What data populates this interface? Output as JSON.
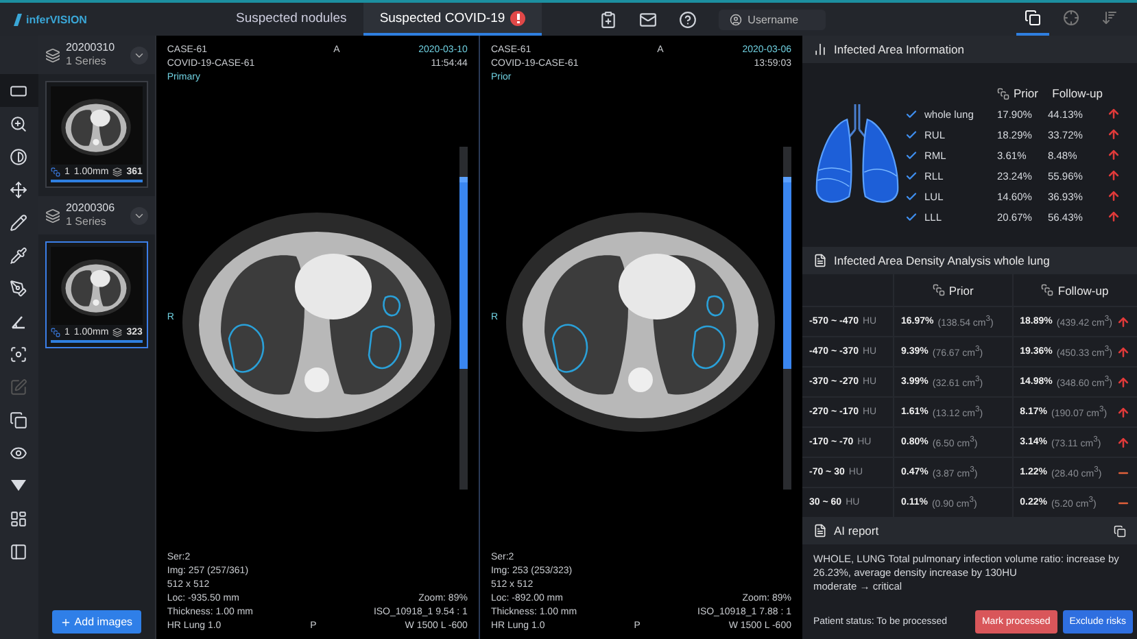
{
  "header": {
    "logo": "inferVISION",
    "tabs": [
      {
        "label": "Suspected nodules",
        "selected": false,
        "alert": false
      },
      {
        "label": "Suspected COVID-19",
        "selected": true,
        "alert": true
      }
    ],
    "actions": [
      {
        "kind": "clipboard"
      },
      {
        "kind": "mail"
      },
      {
        "kind": "help"
      }
    ],
    "user": "Username",
    "view_modes": [
      {
        "kind": "copy",
        "selected": true
      },
      {
        "kind": "target",
        "selected": false
      },
      {
        "kind": "sort",
        "selected": false
      }
    ]
  },
  "tools": [
    {
      "kind": "frame",
      "selected": true,
      "disabled": false
    },
    {
      "kind": "zoom",
      "selected": false,
      "disabled": false
    },
    {
      "kind": "contrast",
      "selected": false,
      "disabled": false
    },
    {
      "kind": "move",
      "selected": false,
      "disabled": false
    },
    {
      "kind": "pencil",
      "selected": false,
      "disabled": false
    },
    {
      "kind": "pipette",
      "selected": false,
      "disabled": false
    },
    {
      "kind": "pen",
      "selected": false,
      "disabled": false
    },
    {
      "kind": "angle",
      "selected": false,
      "disabled": false
    },
    {
      "kind": "focus",
      "selected": false,
      "disabled": false
    },
    {
      "kind": "edit",
      "selected": false,
      "disabled": true
    },
    {
      "kind": "layers",
      "selected": false,
      "disabled": false
    },
    {
      "kind": "eye",
      "selected": false,
      "disabled": false
    },
    {
      "kind": "more",
      "selected": false,
      "disabled": false
    },
    {
      "kind": "grid",
      "selected": false,
      "disabled": false
    },
    {
      "kind": "panel",
      "selected": false,
      "disabled": false
    }
  ],
  "series": [
    {
      "date": "20200310",
      "count": "1 Series",
      "selected": false,
      "slice": "1",
      "thickness": "1.00mm",
      "images": "361"
    },
    {
      "date": "20200306",
      "count": "1 Series",
      "selected": true,
      "slice": "1",
      "thickness": "1.00mm",
      "images": "323"
    }
  ],
  "add_images": "Add images",
  "viewers": [
    {
      "case": "CASE-61",
      "study": "COVID-19-CASE-61",
      "role": "Primary",
      "date": "2020-03-10",
      "time": "11:54:44",
      "top": "A",
      "bottom": "P",
      "left": "R",
      "info_left": [
        "Ser:2",
        "Img: 257 (257/361)",
        "512 x 512",
        "Loc: -935.50 mm",
        "Thickness: 1.00 mm",
        "HR Lung 1.0"
      ],
      "info_right": [
        "Zoom: 89%",
        "ISO_10918_1 9.54 : 1",
        "W 1500 L -600"
      ]
    },
    {
      "case": "CASE-61",
      "study": "COVID-19-CASE-61",
      "role": "Prior",
      "date": "2020-03-06",
      "time": "13:59:03",
      "top": "A",
      "bottom": "P",
      "left": "R",
      "info_left": [
        "Ser:2",
        "Img: 253 (253/323)",
        "512 x 512",
        "Loc: -892.00 mm",
        "Thickness: 1.00 mm",
        "HR Lung 1.0"
      ],
      "info_right": [
        "Zoom: 89%",
        "ISO_10918_1 7.88 : 1",
        "W 1500 L -600"
      ]
    }
  ],
  "infected_area": {
    "title": "Infected Area Information",
    "columns": [
      "Prior",
      "Follow-up"
    ],
    "rows": [
      {
        "label": "whole lung",
        "checked": true,
        "prior": "17.90%",
        "followup": "44.13%",
        "increased": true
      },
      {
        "label": "RUL",
        "checked": true,
        "prior": "18.29%",
        "followup": "33.72%",
        "increased": true
      },
      {
        "label": "RML",
        "checked": true,
        "prior": "3.61%",
        "followup": "8.48%",
        "increased": true
      },
      {
        "label": "RLL",
        "checked": true,
        "prior": "23.24%",
        "followup": "55.96%",
        "increased": true
      },
      {
        "label": "LUL",
        "checked": true,
        "prior": "14.60%",
        "followup": "36.93%",
        "increased": true
      },
      {
        "label": "LLL",
        "checked": true,
        "prior": "20.67%",
        "followup": "56.43%",
        "increased": true
      }
    ]
  },
  "density": {
    "title": "Infected Area Density Analysis whole lung",
    "columns": [
      "Prior",
      "Follow-up"
    ],
    "rows": [
      {
        "range": "-570 ~ -470",
        "unit": "HU",
        "prior": "16.97%",
        "prior_volume": "(138.54 cm$^{3}$)",
        "followup": "18.89%",
        "followup_volume": "(439.42 cm$^{3}$)",
        "increased": true
      },
      {
        "range": "-470 ~ -370",
        "unit": "HU",
        "prior": "9.39%",
        "prior_volume": "(76.67 cm$^{3}$)",
        "followup": "19.36%",
        "followup_volume": "(450.33 cm$^{3}$)",
        "increased": true
      },
      {
        "range": "-370 ~ -270",
        "unit": "HU",
        "prior": "3.99%",
        "prior_volume": "(32.61 cm$^{3}$)",
        "followup": "14.98%",
        "followup_volume": "(348.60 cm$^{3}$)",
        "increased": true
      },
      {
        "range": "-270 ~ -170",
        "unit": "HU",
        "prior": "1.61%",
        "prior_volume": "(13.12 cm$^{3}$)",
        "followup": "8.17%",
        "followup_volume": "(190.07 cm$^{3}$)",
        "increased": true
      },
      {
        "range": "-170 ~ -70",
        "unit": "HU",
        "prior": "0.80%",
        "prior_volume": "(6.50 cm$^{3}$)",
        "followup": "3.14%",
        "followup_volume": "(73.11 cm$^{3}$)",
        "increased": true
      },
      {
        "range": "-70 ~ 30",
        "unit": "HU",
        "prior": "0.47%",
        "prior_volume": "(3.87 cm$^{3}$)",
        "followup": "1.22%",
        "followup_volume": "(28.40 cm$^{3}$)",
        "increased": false
      },
      {
        "range": "30 ~ 60",
        "unit": "HU",
        "prior": "0.11%",
        "prior_volume": "(0.90 cm$^{3}$)",
        "followup": "0.22%",
        "followup_volume": "(5.20 cm$^{3}$)",
        "increased": false
      }
    ]
  },
  "ai_report": {
    "title": "AI report",
    "lines": [
      "WHOLE, LUNG Total pulmonary infection volume ratio: increase by 26.23%, average density increase by 130HU",
      "moderate → critical"
    ]
  },
  "footer": {
    "status": "Patient status: To be processed",
    "buttons": [
      {
        "label": "Mark processed",
        "kind": "danger"
      },
      {
        "label": "Exclude risks",
        "kind": "primary"
      }
    ]
  }
}
